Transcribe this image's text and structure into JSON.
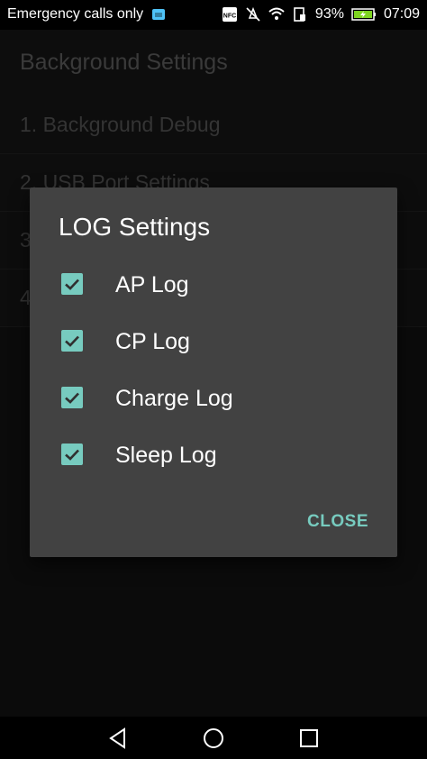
{
  "status_bar": {
    "carrier_text": "Emergency calls only",
    "battery_percent": "93%",
    "time": "07:09",
    "icons": [
      "sim-icon",
      "nfc-icon",
      "mute-icon",
      "wifi-icon",
      "signal-icon",
      "battery-charging-icon"
    ]
  },
  "app_bar": {
    "title": "Background Settings"
  },
  "list": {
    "items": [
      {
        "label": "1. Background Debug"
      },
      {
        "label": "2. USB Port Settings"
      },
      {
        "label": "3"
      },
      {
        "label": "4"
      }
    ]
  },
  "dialog": {
    "title": "LOG Settings",
    "options": [
      {
        "label": "AP Log",
        "checked": true
      },
      {
        "label": "CP Log",
        "checked": true
      },
      {
        "label": "Charge Log",
        "checked": true
      },
      {
        "label": "Sleep Log",
        "checked": true
      }
    ],
    "close_label": "CLOSE"
  },
  "nav_bar": {
    "buttons": [
      "back-icon",
      "home-icon",
      "recents-icon"
    ]
  },
  "colors": {
    "accent": "#77cbbf",
    "dialog_bg": "#424242",
    "background": "#121212"
  }
}
